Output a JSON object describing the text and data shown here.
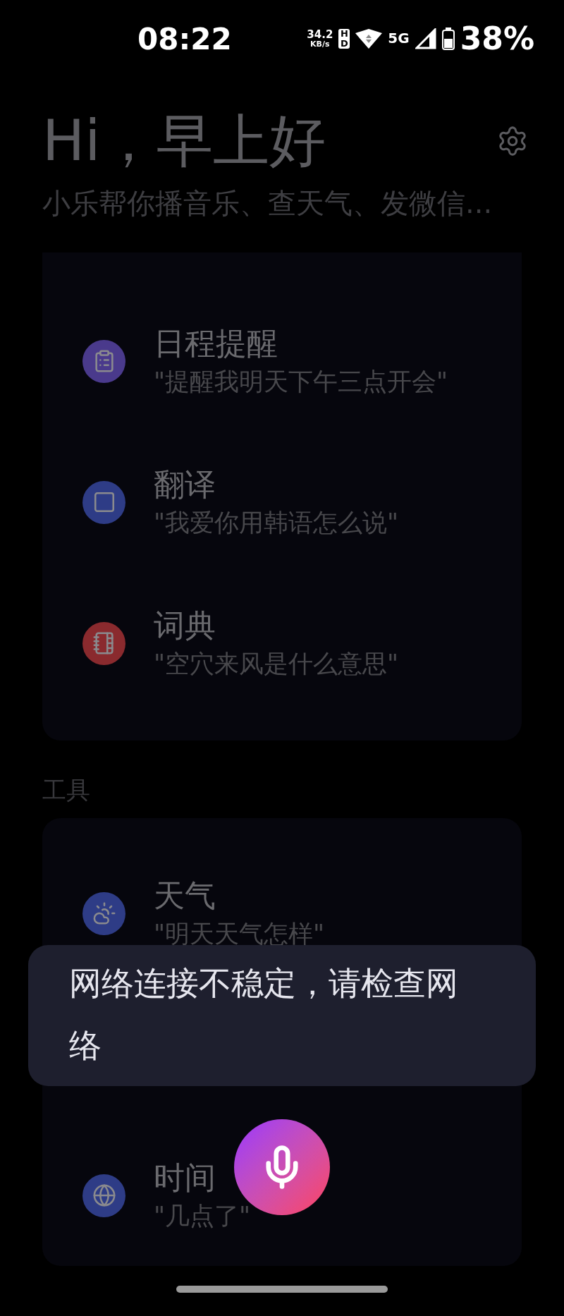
{
  "status_bar": {
    "time": "08:22",
    "speed_value": "34.2",
    "speed_unit": "KB/s",
    "hd": "HD",
    "network": "5G",
    "battery": "38%"
  },
  "header": {
    "title": "Hi，早上好",
    "subtitle": "小乐帮你播音乐、查天气、发微信..."
  },
  "skills": [
    {
      "kind": "list",
      "color": "#4a3a8c",
      "title": "日程提醒",
      "example": "\"提醒我明天下午三点开会\""
    },
    {
      "kind": "square",
      "color": "#2e3c86",
      "title": "翻译",
      "example": "\"我爱你用韩语怎么说\""
    },
    {
      "kind": "notebook",
      "color": "#8a2a2e",
      "title": "词典",
      "example": "\"空穴来风是什么意思\""
    }
  ],
  "tools_section": {
    "label": "工具",
    "items": [
      {
        "kind": "weather",
        "color": "#2e3c86",
        "title": "天气",
        "example": "\"明天天气怎样\""
      },
      {
        "kind": "hidden"
      },
      {
        "kind": "globe",
        "color": "#2e3c86",
        "title": "时间",
        "example": "\"几点了\""
      }
    ]
  },
  "toast": {
    "message": "网络连接不稳定，请检查网络"
  }
}
